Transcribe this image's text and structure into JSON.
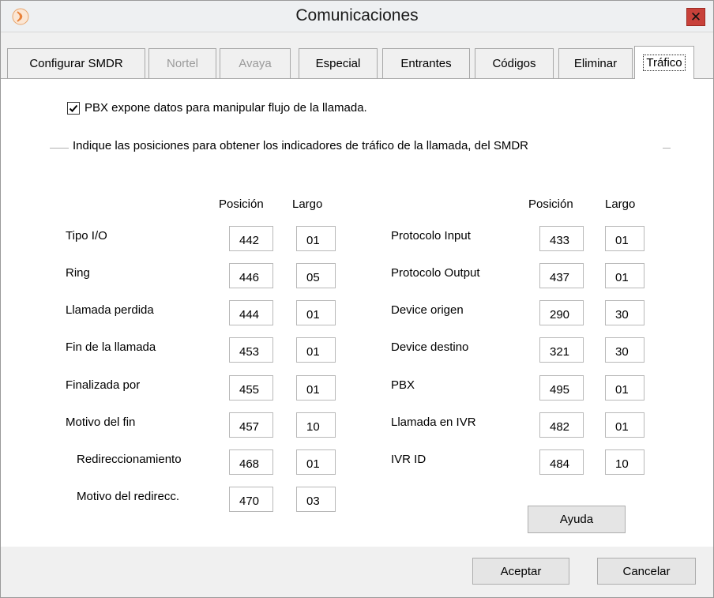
{
  "window": {
    "title": "Comunicaciones",
    "close_glyph": "✕",
    "icon": "app-logo-icon"
  },
  "tabs": [
    {
      "label": "Configurar SMDR",
      "state": "normal"
    },
    {
      "label": "Nortel",
      "state": "disabled"
    },
    {
      "label": "Avaya",
      "state": "disabled"
    },
    {
      "label": "Especial",
      "state": "normal"
    },
    {
      "label": "Entrantes",
      "state": "normal"
    },
    {
      "label": "Códigos",
      "state": "normal"
    },
    {
      "label": "Eliminar",
      "state": "normal"
    },
    {
      "label": "Tráfico",
      "state": "active"
    }
  ],
  "panel": {
    "checkbox_label": "PBX expone datos para manipular flujo de la llamada.",
    "checkbox_checked": true,
    "group_title": "Indique las posiciones para obtener los indicadores de tráfico de la llamada, del SMDR",
    "col_position": "Posición",
    "col_length": "Largo",
    "left_rows": [
      {
        "label": "Tipo I/O",
        "position": "442",
        "length": "01"
      },
      {
        "label": "Ring",
        "position": "446",
        "length": "05"
      },
      {
        "label": "Llamada perdida",
        "position": "444",
        "length": "01"
      },
      {
        "label": "Fin de la llamada",
        "position": "453",
        "length": "01"
      },
      {
        "label": "Finalizada por",
        "position": "455",
        "length": "01"
      },
      {
        "label": "Motivo del fin",
        "position": "457",
        "length": "10"
      },
      {
        "label": "Redireccionamiento",
        "position": "468",
        "length": "01"
      },
      {
        "label": "Motivo del redirecc.",
        "position": "470",
        "length": "03"
      }
    ],
    "right_rows": [
      {
        "label": "Protocolo Input",
        "position": "433",
        "length": "01"
      },
      {
        "label": "Protocolo Output",
        "position": "437",
        "length": "01"
      },
      {
        "label": "Device origen",
        "position": "290",
        "length": "30"
      },
      {
        "label": "Device destino",
        "position": "321",
        "length": "30"
      },
      {
        "label": "PBX",
        "position": "495",
        "length": "01"
      },
      {
        "label": "Llamada en IVR",
        "position": "482",
        "length": "01"
      },
      {
        "label": "IVR ID",
        "position": "484",
        "length": "10"
      }
    ],
    "help_button": "Ayuda"
  },
  "footer": {
    "accept_button": "Aceptar",
    "cancel_button": "Cancelar"
  },
  "colors": {
    "close_button": "#c8413a",
    "app_icon_accent": "#e8823a"
  }
}
